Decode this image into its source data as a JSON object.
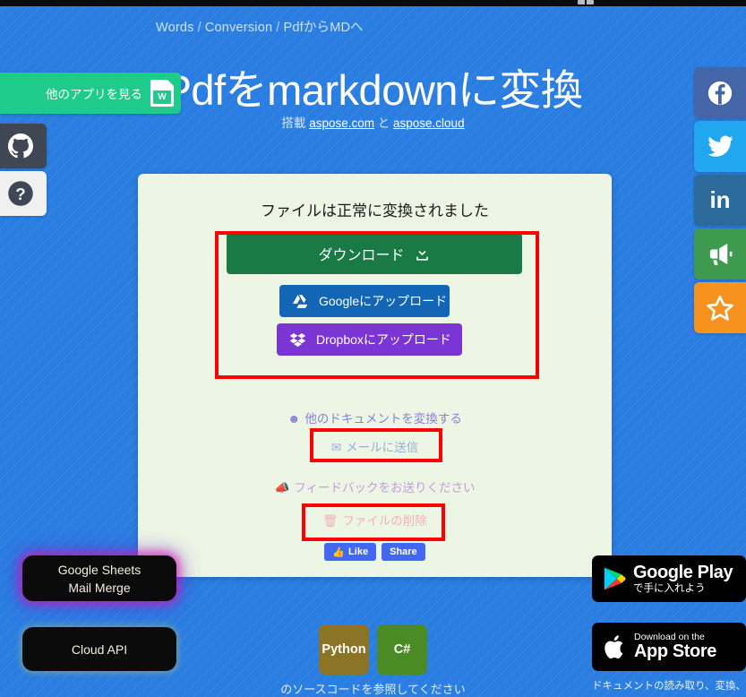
{
  "window": {
    "chrome_fragment": "browser-chrome-sliver"
  },
  "theme": {
    "background_blue": "#2a7de1",
    "card_bg": "#edf5e4",
    "highlight_red": "#ff0000",
    "download_green": "#1a7a46",
    "google_blue": "#1266b5",
    "dropbox_purple": "#7b35d4",
    "accent_green": "#1ecb8b"
  },
  "breadcrumb": {
    "items": [
      "Words",
      "Conversion",
      "PdfからMDへ"
    ],
    "separator": "/"
  },
  "hero": {
    "title": "Pdfをmarkdownに変換",
    "subtitle_prefix": "搭載",
    "subtitle_link1": "aspose.com",
    "subtitle_conj": "と",
    "subtitle_link2": "aspose.cloud",
    "icon": "word-document-icon"
  },
  "other_apps": {
    "label": "他のアプリを見る",
    "icon": "word-document-icon",
    "doc_letter": "W"
  },
  "side_buttons": [
    {
      "name": "github",
      "icon": "github-icon"
    },
    {
      "name": "help",
      "icon": "question-mark-icon"
    }
  ],
  "social_rail": [
    {
      "name": "facebook",
      "icon": "facebook-icon",
      "color": "#4465a8"
    },
    {
      "name": "twitter",
      "icon": "twitter-icon",
      "color": "#21a7f0"
    },
    {
      "name": "linkedin",
      "icon": "linkedin-icon",
      "label": "in",
      "color": "#2c6a9c"
    },
    {
      "name": "announcement",
      "icon": "megaphone-icon",
      "color": "#3e9a4e"
    },
    {
      "name": "favorite",
      "icon": "star-icon",
      "color": "#f7921e"
    }
  ],
  "card": {
    "title": "ファイルは正常に変換されました",
    "download_button": {
      "label": "ダウンロード",
      "icon": "download-icon"
    },
    "google_button": {
      "label": "Googleにアップロード",
      "icon": "google-drive-icon"
    },
    "dropbox_button": {
      "label": "Dropboxにアップロード",
      "icon": "dropbox-icon"
    },
    "convert_other": {
      "label": "他のドキュメントを変換する",
      "icon": "smiley-face-icon"
    },
    "send_email": {
      "label": "メールに送信",
      "icon": "envelope-icon"
    },
    "feedback": {
      "label": "フィードバックをお送りください",
      "icon": "megaphone-icon"
    },
    "delete_file": {
      "label": "ファイルの削除",
      "icon": "trash-icon"
    },
    "facebook_like": {
      "label": "Like",
      "icon": "thumbs-up-icon"
    },
    "facebook_share": {
      "label": "Share"
    }
  },
  "pills": [
    {
      "line1": "Google Sheets",
      "line2": "Mail Merge"
    },
    {
      "line1": "Cloud API",
      "line2": ""
    }
  ],
  "store_badges": {
    "google_play": {
      "small": "で手に入れよう",
      "big": "Google Play",
      "icon": "google-play-icon"
    },
    "app_store": {
      "small": "Download on the",
      "big": "App Store",
      "icon": "apple-icon"
    }
  },
  "lang_buttons": [
    {
      "label": "Python",
      "color": "#8b7426"
    },
    {
      "label": "C#",
      "color": "#4b8b26"
    }
  ],
  "lang_caption": "のソースコードを参照してください",
  "bottom_caption": "ドキュメントの読み取り、変換、マージ、分"
}
